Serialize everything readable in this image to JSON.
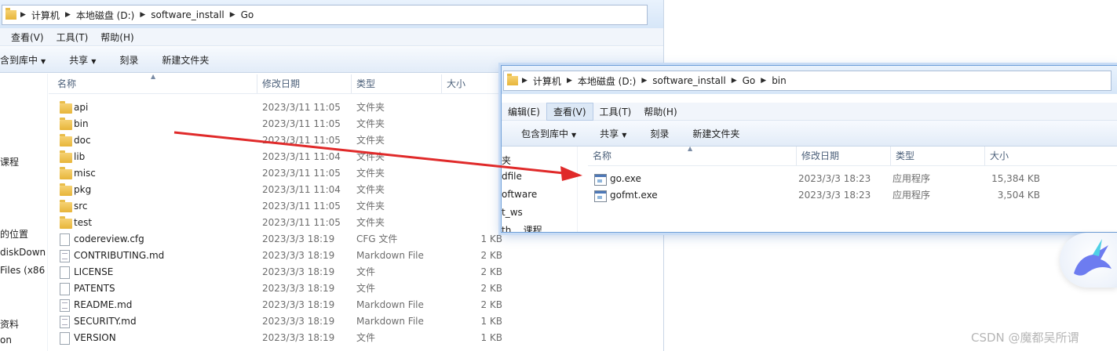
{
  "left_window": {
    "address": [
      "计算机",
      "本地磁盘 (D:)",
      "software_install",
      "Go"
    ],
    "menus": [
      "查看(V)",
      "工具(T)",
      "帮助(H)"
    ],
    "toolbar": {
      "include": "含到库中",
      "share": "共享",
      "burn": "刻录",
      "new_folder": "新建文件夹"
    },
    "columns": [
      "名称",
      "修改日期",
      "类型",
      "大小"
    ],
    "nav_items": [
      "课程",
      "的位置",
      "diskDown",
      "Files (x86",
      "资料",
      "on"
    ],
    "files": [
      {
        "name": "api",
        "date": "2023/3/11 11:05",
        "type": "文件夹",
        "size": "",
        "icon": "folder-icon"
      },
      {
        "name": "bin",
        "date": "2023/3/11 11:05",
        "type": "文件夹",
        "size": "",
        "icon": "folder-icon"
      },
      {
        "name": "doc",
        "date": "2023/3/11 11:05",
        "type": "文件夹",
        "size": "",
        "icon": "folder-icon"
      },
      {
        "name": "lib",
        "date": "2023/3/11 11:04",
        "type": "文件夹",
        "size": "",
        "icon": "folder-icon"
      },
      {
        "name": "misc",
        "date": "2023/3/11 11:05",
        "type": "文件夹",
        "size": "",
        "icon": "folder-icon"
      },
      {
        "name": "pkg",
        "date": "2023/3/11 11:04",
        "type": "文件夹",
        "size": "",
        "icon": "folder-icon"
      },
      {
        "name": "src",
        "date": "2023/3/11 11:05",
        "type": "文件夹",
        "size": "",
        "icon": "folder-icon"
      },
      {
        "name": "test",
        "date": "2023/3/11 11:05",
        "type": "文件夹",
        "size": "",
        "icon": "folder-icon"
      },
      {
        "name": "codereview.cfg",
        "date": "2023/3/3 18:19",
        "type": "CFG 文件",
        "size": "1 KB",
        "icon": "file-icon"
      },
      {
        "name": "CONTRIBUTING.md",
        "date": "2023/3/3 18:19",
        "type": "Markdown File",
        "size": "2 KB",
        "icon": "text-file-icon"
      },
      {
        "name": "LICENSE",
        "date": "2023/3/3 18:19",
        "type": "文件",
        "size": "2 KB",
        "icon": "file-icon"
      },
      {
        "name": "PATENTS",
        "date": "2023/3/3 18:19",
        "type": "文件",
        "size": "2 KB",
        "icon": "file-icon"
      },
      {
        "name": "README.md",
        "date": "2023/3/3 18:19",
        "type": "Markdown File",
        "size": "2 KB",
        "icon": "text-file-icon"
      },
      {
        "name": "SECURITY.md",
        "date": "2023/3/3 18:19",
        "type": "Markdown File",
        "size": "1 KB",
        "icon": "text-file-icon"
      },
      {
        "name": "VERSION",
        "date": "2023/3/3 18:19",
        "type": "文件",
        "size": "1 KB",
        "icon": "file-icon"
      }
    ]
  },
  "right_window": {
    "address": [
      "计算机",
      "本地磁盘 (D:)",
      "software_install",
      "Go",
      "bin"
    ],
    "menus": [
      "编辑(E)",
      "查看(V)",
      "工具(T)",
      "帮助(H)"
    ],
    "active_menu": "查看(V)",
    "toolbar": {
      "include": "包含到库中",
      "share": "共享",
      "burn": "刻录",
      "new_folder": "新建文件夹"
    },
    "columns": [
      "名称",
      "修改日期",
      "类型",
      "大小"
    ],
    "nav_items": [
      "夹",
      "dfile",
      "oftware",
      "t_ws",
      "th... 课程"
    ],
    "files": [
      {
        "name": "go.exe",
        "date": "2023/3/3 18:23",
        "type": "应用程序",
        "size": "15,384 KB",
        "icon": "exe-icon"
      },
      {
        "name": "gofmt.exe",
        "date": "2023/3/3 18:23",
        "type": "应用程序",
        "size": "3,504 KB",
        "icon": "exe-icon"
      }
    ]
  },
  "watermark": "CSDN @魔都吴所谓",
  "colors": {
    "arrow": "#e02a2a",
    "accent": "#6f9fd8"
  }
}
